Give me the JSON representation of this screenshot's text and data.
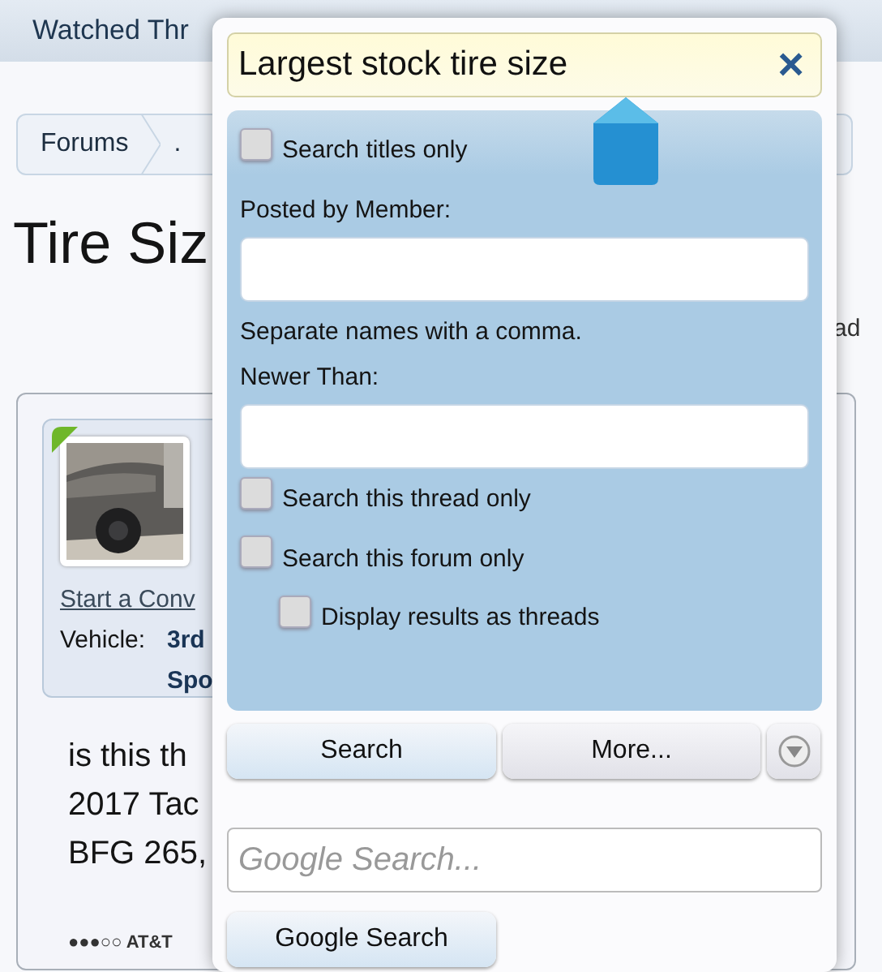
{
  "header": {
    "link": "Watched Thr"
  },
  "breadcrumb": {
    "items": [
      "Forums",
      "."
    ]
  },
  "thread_title": "Tire Siz",
  "side_text": "ad",
  "post": {
    "user_link": "Start a Conv",
    "vehicle_label": "Vehicle:",
    "vehicle_lines": [
      "3rd",
      "Spo"
    ],
    "message_lines": [
      "is this th",
      "2017 Tac",
      "BFG 265,"
    ],
    "embedded_status": "●●●○○ AT&T"
  },
  "search_popup": {
    "query": "Largest stock tire size",
    "clear": "×",
    "options": [
      {
        "kind": "checkbox",
        "label": "Search titles only",
        "checked": false
      },
      {
        "kind": "label",
        "label": "Posted by Member:"
      },
      {
        "kind": "field"
      },
      {
        "kind": "hint",
        "label": "Separate names with a comma."
      },
      {
        "kind": "label",
        "label": "Newer Than:"
      },
      {
        "kind": "field"
      },
      {
        "kind": "checkbox",
        "label": "Search this thread only",
        "checked": false
      },
      {
        "kind": "checkbox",
        "label": "Search this forum only",
        "checked": false,
        "children": [
          {
            "kind": "checkbox",
            "label": "Display results as threads",
            "checked": false
          }
        ]
      }
    ],
    "buttons": [
      "Search",
      "More..."
    ],
    "google": {
      "placeholder": "Google Search...",
      "button": "Google Search"
    }
  }
}
